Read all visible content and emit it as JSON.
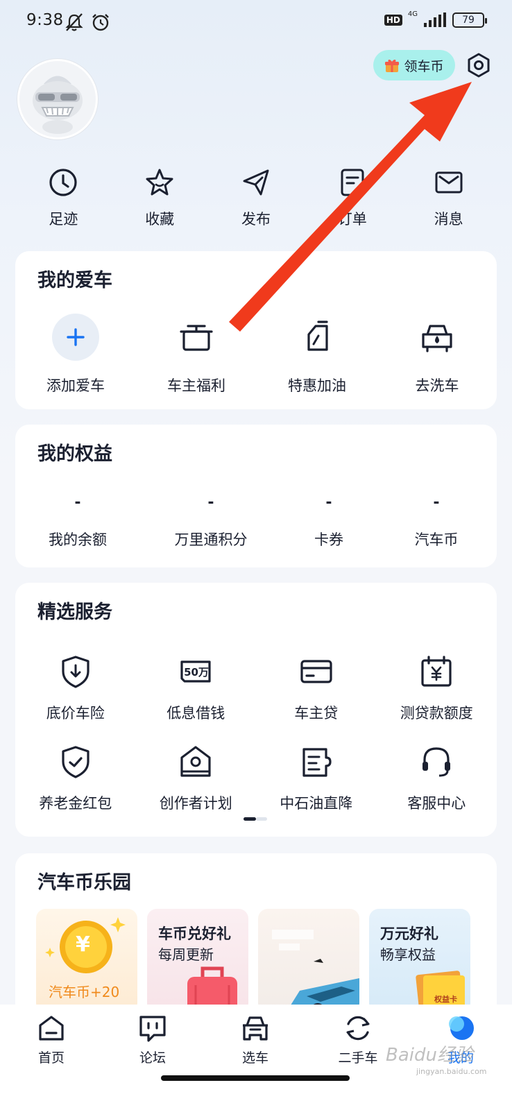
{
  "status_bar": {
    "time": "9:38",
    "hd": "HD",
    "network": "4G",
    "battery": "79"
  },
  "header": {
    "coin_button": "领车币"
  },
  "quick_actions": [
    {
      "label": "足迹",
      "icon": "clock-icon"
    },
    {
      "label": "收藏",
      "icon": "star-icon"
    },
    {
      "label": "发布",
      "icon": "send-icon"
    },
    {
      "label": "订单",
      "icon": "order-icon"
    },
    {
      "label": "消息",
      "icon": "mail-icon"
    }
  ],
  "my_car": {
    "title": "我的爱车",
    "items": [
      {
        "label": "添加爱车",
        "icon": "plus-icon"
      },
      {
        "label": "车主福利",
        "icon": "gift-box-icon"
      },
      {
        "label": "特惠加油",
        "icon": "fuel-can-icon"
      },
      {
        "label": "去洗车",
        "icon": "car-wash-icon"
      }
    ]
  },
  "my_rights": {
    "title": "我的权益",
    "items": [
      {
        "value": "-",
        "label": "我的余额"
      },
      {
        "value": "-",
        "label": "万里通积分"
      },
      {
        "value": "-",
        "label": "卡券"
      },
      {
        "value": "-",
        "label": "汽车币"
      }
    ]
  },
  "services": {
    "title": "精选服务",
    "items": [
      {
        "label": "底价车险",
        "icon": "shield-download-icon"
      },
      {
        "label": "低息借钱",
        "icon": "loan-50w-icon",
        "icon_text": "50万"
      },
      {
        "label": "车主贷",
        "icon": "card-icon"
      },
      {
        "label": "测贷款额度",
        "icon": "calendar-yuan-icon"
      },
      {
        "label": "养老金红包",
        "icon": "shield-check-icon"
      },
      {
        "label": "创作者计划",
        "icon": "creator-icon"
      },
      {
        "label": "中石油直降",
        "icon": "ticket-icon"
      },
      {
        "label": "客服中心",
        "icon": "headset-icon"
      }
    ]
  },
  "coin_park": {
    "title": "汽车币乐园",
    "cards": [
      {
        "title": "",
        "subtitle": "汽车币+20",
        "coin_symbol": "¥"
      },
      {
        "title": "车币兑好礼",
        "subtitle": "每周更新"
      },
      {
        "title": "",
        "subtitle": ""
      },
      {
        "title": "万元好礼",
        "subtitle": "畅享权益",
        "badge": "权益卡"
      }
    ]
  },
  "bottom_nav": [
    {
      "label": "首页",
      "icon": "home-icon",
      "active": false
    },
    {
      "label": "论坛",
      "icon": "forum-icon",
      "active": false
    },
    {
      "label": "选车",
      "icon": "car-select-icon",
      "active": false
    },
    {
      "label": "二手车",
      "icon": "used-car-icon",
      "active": false
    },
    {
      "label": "我的",
      "icon": "profile-icon",
      "active": true
    }
  ],
  "watermark": {
    "text": "Baidu经验",
    "sub": "jingyan.baidu.com"
  },
  "colors": {
    "accent": "#1a74f2",
    "coin_button_bg": "#a9f0ec",
    "arrow": "#f03a1c"
  }
}
